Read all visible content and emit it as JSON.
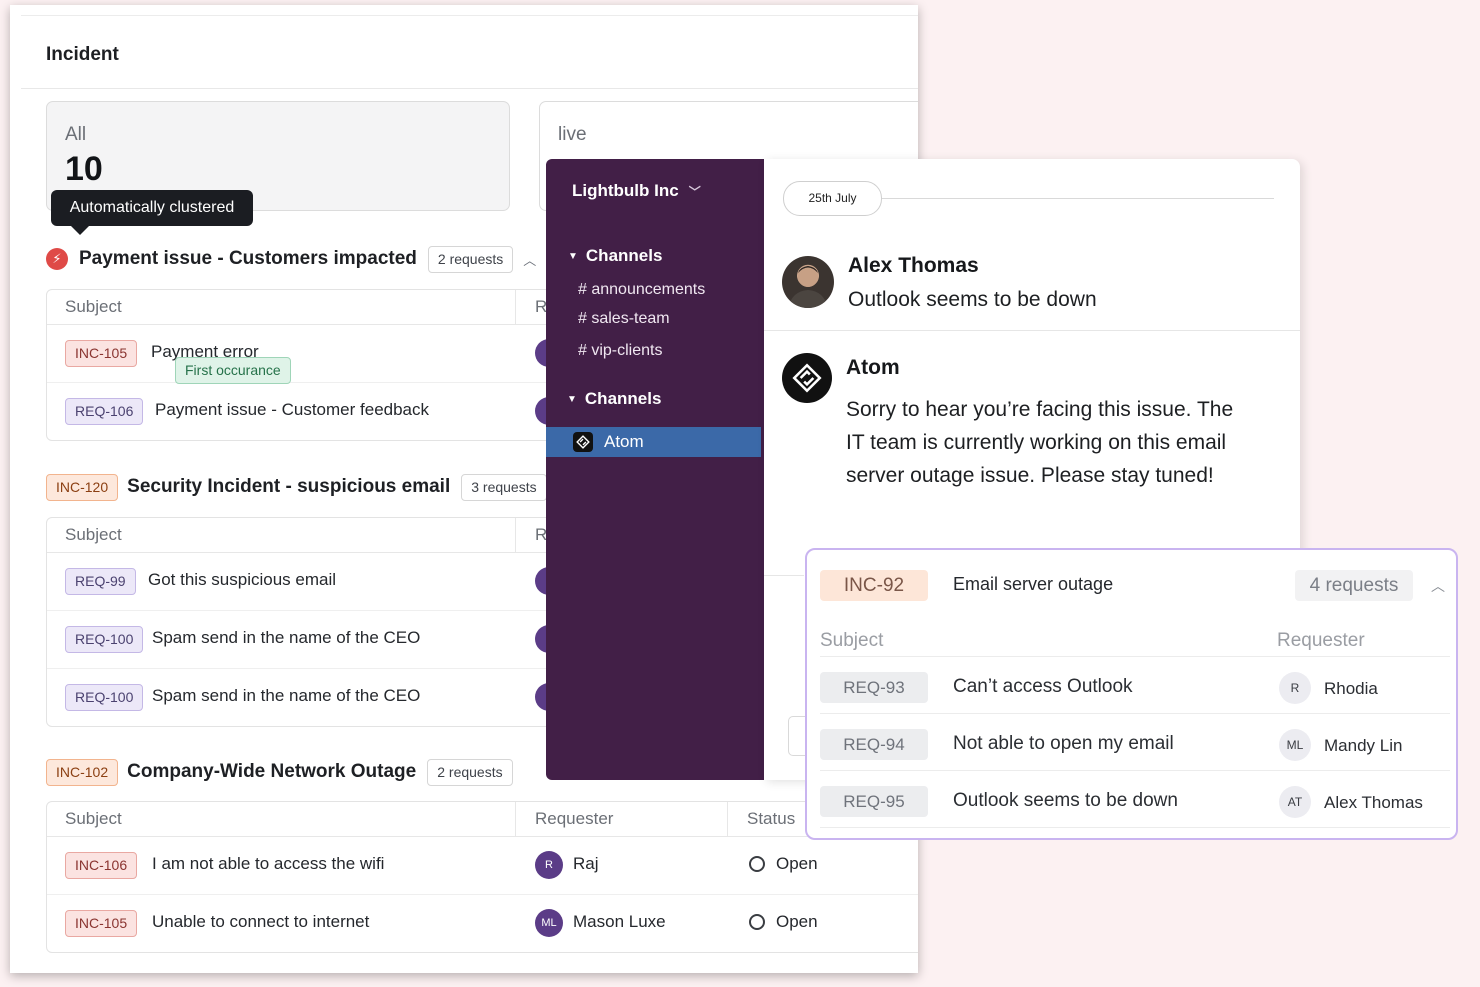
{
  "incident": {
    "title": "Incident",
    "stats": {
      "all_label": "All",
      "all_value": "10",
      "live_label": "live"
    },
    "tooltip": "Automatically clustered",
    "groups": [
      {
        "id": "",
        "title": "Payment issue - Customers impacted",
        "count": "2 requests",
        "columns": [
          "Subject",
          "R"
        ],
        "rows": [
          {
            "tag": "INC-105",
            "subject": "Payment error",
            "badge": "First occurance"
          },
          {
            "tag": "REQ-106",
            "subject": "Payment issue - Customer feedback"
          }
        ]
      },
      {
        "id": "INC-120",
        "title": "Security Incident - suspicious email",
        "count": "3 requests",
        "columns": [
          "Subject",
          "R"
        ],
        "rows": [
          {
            "tag": "REQ-99",
            "subject": "Got this suspicious email"
          },
          {
            "tag": "REQ-100",
            "subject": "Spam send in the name of the CEO"
          },
          {
            "tag": "REQ-100",
            "subject": "Spam send in the name of the CEO"
          }
        ]
      },
      {
        "id": "INC-102",
        "title": "Company-Wide Network Outage",
        "count": "2 requests",
        "columns": [
          "Subject",
          "Requester",
          "Status"
        ],
        "rows": [
          {
            "tag": "INC-106",
            "subject": "I am not able to access the wifi",
            "avatar": "R",
            "requester": "Raj",
            "status": "Open"
          },
          {
            "tag": "INC-105",
            "subject": "Unable to connect to internet",
            "avatar": "ML",
            "requester": "Mason Luxe",
            "status": "Open"
          }
        ]
      }
    ]
  },
  "slack": {
    "workspace": "Lightbulb Inc",
    "sections": [
      {
        "label": "Channels",
        "channels": [
          "# announcements",
          "# sales-team",
          "# vip-clients"
        ]
      },
      {
        "label": "Channels",
        "channels": [
          "Atom"
        ]
      }
    ]
  },
  "chat": {
    "date": "25th July",
    "messages": [
      {
        "author": "Alex Thomas",
        "text": "Outlook seems to be down"
      },
      {
        "author": "Atom",
        "lines": [
          "Sorry to hear you’re facing this issue. The",
          "IT team is currently working on this email",
          "server outage issue. Please stay tuned!"
        ]
      }
    ]
  },
  "card": {
    "id": "INC-92",
    "title": "Email server outage",
    "count": "4 requests",
    "columns": [
      "Subject",
      "Requester"
    ],
    "rows": [
      {
        "tag": "REQ-93",
        "subject": "Can’t access Outlook",
        "avatar": "R",
        "requester": "Rhodia"
      },
      {
        "tag": "REQ-94",
        "subject": "Not able to open my email",
        "avatar": "ML",
        "requester": "Mandy Lin"
      },
      {
        "tag": "REQ-95",
        "subject": "Outlook seems to be down",
        "avatar": "AT",
        "requester": "Alex Thomas"
      }
    ]
  },
  "colors": {
    "slack_sidebar": "#421f47",
    "selected": "#3b69a8",
    "card_border": "#c9b4f0",
    "incident_red": "#df4a47"
  }
}
